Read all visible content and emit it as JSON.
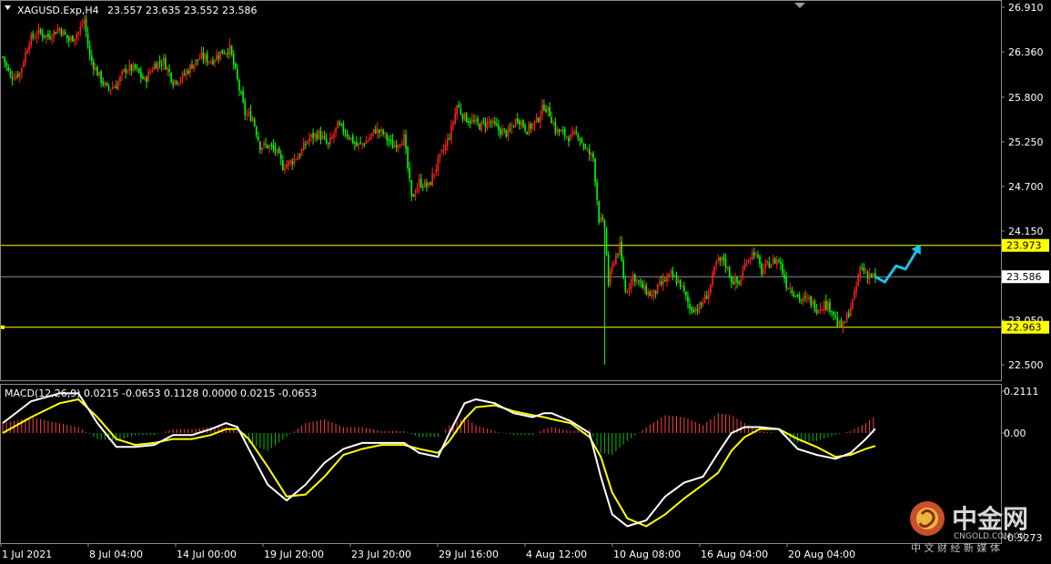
{
  "header": {
    "symbol_label": "XAGUSD.Exp,H4",
    "ohlc": "23.557 23.635 23.552 23.586",
    "menu_icon": "triangle-down-icon",
    "corner_icon": "triangle-down-icon"
  },
  "macd_header": {
    "label": "MACD(12,26,9) 0.0215 -0.0653 0.1128 0.0000 0.0215 -0.0653"
  },
  "watermark": {
    "brand": "中金网",
    "domain": "CNGOLD.COM.CN",
    "tagline": "中 文 财 经 新 媒 体",
    "logo_icon": "cngold-logo-icon"
  },
  "colors": {
    "background": "#000000",
    "bull": "#ff2020",
    "bear": "#00ff00",
    "level_line": "#ffff00",
    "current_line": "#8c8caa",
    "macd_line": "#ffffff",
    "signal_line": "#ffff00",
    "hist_pos": "#ff4040",
    "hist_neg": "#00c000",
    "arrow": "#19c3e6"
  },
  "chart_data": [
    {
      "type": "candlestick",
      "symbol": "XAGUSD.Exp",
      "timeframe": "H4",
      "ylim": [
        22.25,
        27.05
      ],
      "y_ticks": [
        "26.910",
        "26.360",
        "25.800",
        "25.250",
        "24.700",
        "24.150",
        "23.050",
        "22.500"
      ],
      "x_ticks": [
        "1 Jul 2021",
        "8 Jul 04:00",
        "14 Jul 00:00",
        "19 Jul 20:00",
        "23 Jul 20:00",
        "29 Jul 16:00",
        "4 Aug 12:00",
        "10 Aug 08:00",
        "16 Aug 04:00",
        "20 Aug 04:00"
      ],
      "horizontal_levels": [
        {
          "value": 23.973,
          "label": "23.973",
          "style": "level"
        },
        {
          "value": 23.586,
          "label": "23.586",
          "style": "current"
        },
        {
          "value": 22.963,
          "label": "22.963",
          "style": "level"
        }
      ],
      "close_path": [
        [
          0,
          26.3
        ],
        [
          4,
          26.05
        ],
        [
          9,
          26.1
        ],
        [
          14,
          26.5
        ],
        [
          19,
          26.6
        ],
        [
          24,
          26.55
        ],
        [
          30,
          26.65
        ],
        [
          35,
          26.5
        ],
        [
          40,
          26.6
        ],
        [
          43,
          26.75
        ],
        [
          46,
          26.3
        ],
        [
          50,
          26.1
        ],
        [
          55,
          25.9
        ],
        [
          60,
          25.95
        ],
        [
          65,
          26.15
        ],
        [
          70,
          26.15
        ],
        [
          75,
          26.0
        ],
        [
          80,
          26.2
        ],
        [
          85,
          26.25
        ],
        [
          90,
          26.0
        ],
        [
          95,
          26.05
        ],
        [
          100,
          26.2
        ],
        [
          105,
          26.3
        ],
        [
          110,
          26.25
        ],
        [
          115,
          26.35
        ],
        [
          120,
          26.4
        ],
        [
          124,
          26.0
        ],
        [
          128,
          25.6
        ],
        [
          132,
          25.55
        ],
        [
          136,
          25.2
        ],
        [
          140,
          25.2
        ],
        [
          144,
          25.15
        ],
        [
          148,
          24.95
        ],
        [
          152,
          25.0
        ],
        [
          157,
          25.1
        ],
        [
          162,
          25.3
        ],
        [
          167,
          25.35
        ],
        [
          172,
          25.2
        ],
        [
          177,
          25.45
        ],
        [
          182,
          25.35
        ],
        [
          187,
          25.2
        ],
        [
          192,
          25.25
        ],
        [
          197,
          25.4
        ],
        [
          201,
          25.35
        ],
        [
          206,
          25.2
        ],
        [
          212,
          25.3
        ],
        [
          216,
          24.55
        ],
        [
          220,
          24.75
        ],
        [
          225,
          24.7
        ],
        [
          230,
          25.0
        ],
        [
          234,
          25.2
        ],
        [
          237,
          25.4
        ],
        [
          240,
          25.7
        ],
        [
          244,
          25.55
        ],
        [
          248,
          25.5
        ],
        [
          252,
          25.45
        ],
        [
          257,
          25.5
        ],
        [
          262,
          25.4
        ],
        [
          267,
          25.35
        ],
        [
          272,
          25.55
        ],
        [
          277,
          25.4
        ],
        [
          282,
          25.5
        ],
        [
          286,
          25.7
        ],
        [
          289,
          25.6
        ],
        [
          292,
          25.4
        ],
        [
          296,
          25.35
        ],
        [
          300,
          25.3
        ],
        [
          304,
          25.35
        ],
        [
          308,
          25.15
        ],
        [
          312,
          25.05
        ],
        [
          315,
          24.3
        ],
        [
          318,
          24.2
        ],
        [
          320,
          23.5
        ],
        [
          323,
          23.8
        ],
        [
          326,
          23.95
        ],
        [
          329,
          23.4
        ],
        [
          333,
          23.6
        ],
        [
          338,
          23.45
        ],
        [
          343,
          23.35
        ],
        [
          348,
          23.5
        ],
        [
          353,
          23.6
        ],
        [
          358,
          23.5
        ],
        [
          363,
          23.2
        ],
        [
          368,
          23.2
        ],
        [
          373,
          23.4
        ],
        [
          377,
          23.75
        ],
        [
          381,
          23.8
        ],
        [
          385,
          23.55
        ],
        [
          389,
          23.5
        ],
        [
          393,
          23.8
        ],
        [
          397,
          23.9
        ],
        [
          401,
          23.65
        ],
        [
          405,
          23.75
        ],
        [
          410,
          23.8
        ],
        [
          414,
          23.5
        ],
        [
          418,
          23.4
        ],
        [
          422,
          23.3
        ],
        [
          426,
          23.3
        ],
        [
          430,
          23.2
        ],
        [
          434,
          23.25
        ],
        [
          438,
          23.2
        ],
        [
          441,
          23.0
        ],
        [
          444,
          22.97
        ],
        [
          447,
          23.15
        ],
        [
          450,
          23.35
        ],
        [
          453,
          23.7
        ],
        [
          457,
          23.62
        ],
        [
          461,
          23.586
        ]
      ],
      "price_range": [
        22.5,
        26.8
      ],
      "events": [
        {
          "type": "spike_low",
          "at": 318,
          "value": 22.5
        },
        {
          "type": "projection_arrow",
          "points": [
            [
              461,
              23.586
            ],
            [
              466,
              23.52
            ],
            [
              472,
              23.72
            ],
            [
              477,
              23.68
            ],
            [
              484,
              23.95
            ]
          ]
        }
      ]
    },
    {
      "type": "macd",
      "title": "MACD(12,26,9)",
      "params": {
        "fast": 12,
        "slow": 26,
        "signal": 9
      },
      "values": [
        0.0215,
        -0.0653,
        0.1128,
        0.0,
        0.0215,
        -0.0653
      ],
      "ylim": [
        -0.5273,
        0.2111
      ],
      "y_ticks": [
        "0.2111",
        "0.00",
        "-0.5273"
      ],
      "macd_series": [
        [
          0,
          0.05
        ],
        [
          15,
          0.16
        ],
        [
          30,
          0.2
        ],
        [
          40,
          0.2
        ],
        [
          50,
          0.05
        ],
        [
          60,
          -0.07
        ],
        [
          70,
          -0.07
        ],
        [
          80,
          -0.06
        ],
        [
          90,
          -0.01
        ],
        [
          100,
          -0.01
        ],
        [
          110,
          0.02
        ],
        [
          118,
          0.05
        ],
        [
          124,
          0.03
        ],
        [
          130,
          -0.08
        ],
        [
          140,
          -0.26
        ],
        [
          150,
          -0.34
        ],
        [
          160,
          -0.26
        ],
        [
          170,
          -0.15
        ],
        [
          180,
          -0.08
        ],
        [
          190,
          -0.05
        ],
        [
          200,
          -0.05
        ],
        [
          212,
          -0.05
        ],
        [
          220,
          -0.1
        ],
        [
          230,
          -0.12
        ],
        [
          236,
          0.0
        ],
        [
          244,
          0.15
        ],
        [
          250,
          0.17
        ],
        [
          260,
          0.15
        ],
        [
          270,
          0.1
        ],
        [
          280,
          0.08
        ],
        [
          286,
          0.1
        ],
        [
          290,
          0.1
        ],
        [
          300,
          0.06
        ],
        [
          310,
          0.0
        ],
        [
          316,
          -0.22
        ],
        [
          322,
          -0.41
        ],
        [
          330,
          -0.47
        ],
        [
          340,
          -0.44
        ],
        [
          350,
          -0.32
        ],
        [
          360,
          -0.25
        ],
        [
          370,
          -0.22
        ],
        [
          378,
          -0.1
        ],
        [
          385,
          0.0
        ],
        [
          392,
          0.03
        ],
        [
          400,
          0.03
        ],
        [
          410,
          0.02
        ],
        [
          420,
          -0.08
        ],
        [
          430,
          -0.11
        ],
        [
          440,
          -0.13
        ],
        [
          448,
          -0.1
        ],
        [
          456,
          -0.03
        ],
        [
          461,
          0.0215
        ]
      ],
      "signal_series": [
        [
          0,
          0.0
        ],
        [
          15,
          0.08
        ],
        [
          30,
          0.15
        ],
        [
          40,
          0.17
        ],
        [
          50,
          0.08
        ],
        [
          60,
          -0.03
        ],
        [
          70,
          -0.06
        ],
        [
          80,
          -0.05
        ],
        [
          90,
          -0.03
        ],
        [
          100,
          -0.03
        ],
        [
          110,
          -0.01
        ],
        [
          118,
          0.02
        ],
        [
          124,
          0.02
        ],
        [
          130,
          -0.03
        ],
        [
          140,
          -0.17
        ],
        [
          150,
          -0.32
        ],
        [
          160,
          -0.31
        ],
        [
          170,
          -0.22
        ],
        [
          180,
          -0.11
        ],
        [
          190,
          -0.08
        ],
        [
          200,
          -0.06
        ],
        [
          212,
          -0.06
        ],
        [
          220,
          -0.08
        ],
        [
          230,
          -0.1
        ],
        [
          236,
          -0.04
        ],
        [
          244,
          0.07
        ],
        [
          250,
          0.13
        ],
        [
          260,
          0.14
        ],
        [
          270,
          0.11
        ],
        [
          280,
          0.09
        ],
        [
          286,
          0.08
        ],
        [
          290,
          0.07
        ],
        [
          300,
          0.05
        ],
        [
          310,
          -0.02
        ],
        [
          316,
          -0.12
        ],
        [
          322,
          -0.3
        ],
        [
          330,
          -0.43
        ],
        [
          340,
          -0.47
        ],
        [
          350,
          -0.41
        ],
        [
          360,
          -0.33
        ],
        [
          370,
          -0.26
        ],
        [
          378,
          -0.2
        ],
        [
          385,
          -0.09
        ],
        [
          392,
          -0.02
        ],
        [
          400,
          0.02
        ],
        [
          410,
          0.02
        ],
        [
          420,
          -0.03
        ],
        [
          430,
          -0.07
        ],
        [
          440,
          -0.12
        ],
        [
          448,
          -0.11
        ],
        [
          456,
          -0.08
        ],
        [
          461,
          -0.0653
        ]
      ]
    }
  ]
}
